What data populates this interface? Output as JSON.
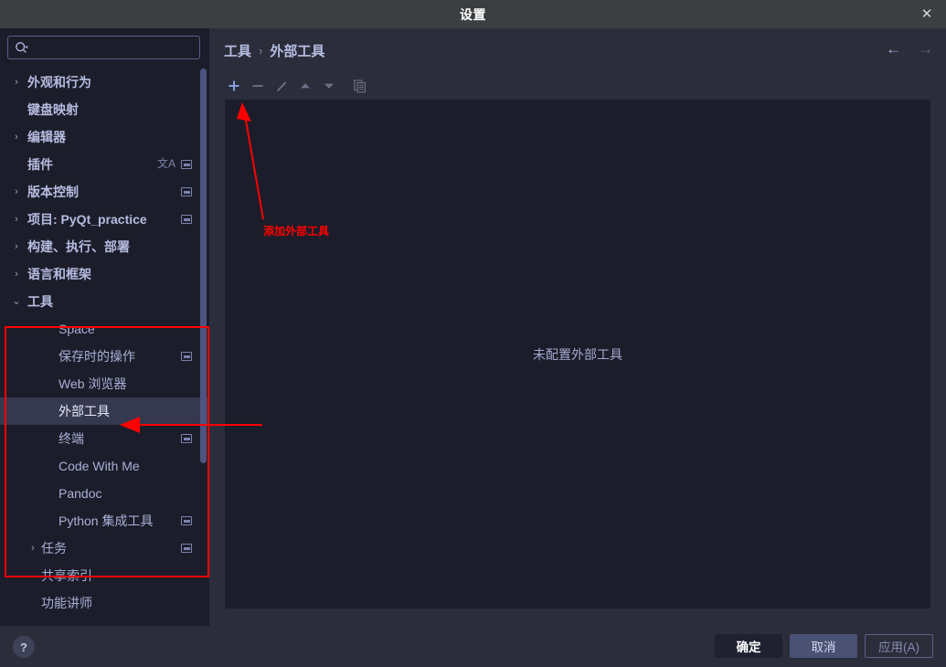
{
  "window": {
    "title": "设置",
    "close_icon": "close-icon"
  },
  "sidebar": {
    "search": {
      "placeholder": "",
      "value": "",
      "icon": "search-icon"
    },
    "items": [
      {
        "label": "外观和行为",
        "level": 0,
        "chevron": "›",
        "badge": false
      },
      {
        "label": "键盘映射",
        "level": 0,
        "chevron": "",
        "badge": false
      },
      {
        "label": "编辑器",
        "level": 0,
        "chevron": "›",
        "badge": false
      },
      {
        "label": "插件",
        "level": 0,
        "chevron": "",
        "badge": true,
        "translate_badge": "文A"
      },
      {
        "label": "版本控制",
        "level": 0,
        "chevron": "›",
        "badge": true
      },
      {
        "label": "项目: PyQt_practice",
        "level": 0,
        "chevron": "›",
        "badge": true
      },
      {
        "label": "构建、执行、部署",
        "level": 0,
        "chevron": "›",
        "badge": false
      },
      {
        "label": "语言和框架",
        "level": 0,
        "chevron": "›",
        "badge": false
      },
      {
        "label": "工具",
        "level": 0,
        "chevron": "⌄",
        "badge": false
      },
      {
        "label": "Space",
        "level": 2,
        "chevron": "",
        "badge": false
      },
      {
        "label": "保存时的操作",
        "level": 2,
        "chevron": "",
        "badge": true
      },
      {
        "label": "Web 浏览器",
        "level": 2,
        "chevron": "",
        "badge": false
      },
      {
        "label": "外部工具",
        "level": 2,
        "chevron": "",
        "badge": false,
        "selected": true
      },
      {
        "label": "终端",
        "level": 2,
        "chevron": "",
        "badge": true
      },
      {
        "label": "Code With Me",
        "level": 2,
        "chevron": "",
        "badge": false
      },
      {
        "label": "Pandoc",
        "level": 2,
        "chevron": "",
        "badge": false
      },
      {
        "label": "Python 集成工具",
        "level": 2,
        "chevron": "",
        "badge": true
      },
      {
        "label": "任务",
        "level": 1,
        "chevron": "›",
        "badge": true
      },
      {
        "label": "共享索引",
        "level": 1,
        "chevron": "",
        "badge": false
      },
      {
        "label": "功能讲师",
        "level": 1,
        "chevron": "",
        "badge": false
      }
    ]
  },
  "main": {
    "breadcrumb": {
      "parent": "工具",
      "separator": "›",
      "current": "外部工具"
    },
    "nav": {
      "back": "←",
      "forward": "→"
    },
    "toolbar": [
      {
        "name": "add-tool-button",
        "glyph": "+",
        "state": "enabled"
      },
      {
        "name": "remove-tool-button",
        "glyph": "−",
        "state": "disabled"
      },
      {
        "name": "edit-tool-button",
        "glyph": "pencil",
        "state": "disabled"
      },
      {
        "name": "move-up-button",
        "glyph": "▲",
        "state": "disabled"
      },
      {
        "name": "move-down-button",
        "glyph": "▼",
        "state": "disabled"
      },
      {
        "name": "copy-tool-button",
        "glyph": "copy",
        "state": "disabled"
      }
    ],
    "empty_message": "未配置外部工具"
  },
  "footer": {
    "help_label": "?",
    "buttons": [
      {
        "label": "确定",
        "style": "primary"
      },
      {
        "label": "取消",
        "style": "hover"
      },
      {
        "label": "应用(A)",
        "style": "outline"
      }
    ]
  },
  "annotations": {
    "accent_color": "#ff0000",
    "add_tool_label": "添加外部工具"
  },
  "theme": {
    "titlebar_bg": "#3c3f41",
    "dialog_bg": "#2b2d3a",
    "panel_bg": "#1c1d2a",
    "selection_bg": "#35384e",
    "text": "#a9b0d6",
    "accent_icon": "#7b9fe8"
  }
}
